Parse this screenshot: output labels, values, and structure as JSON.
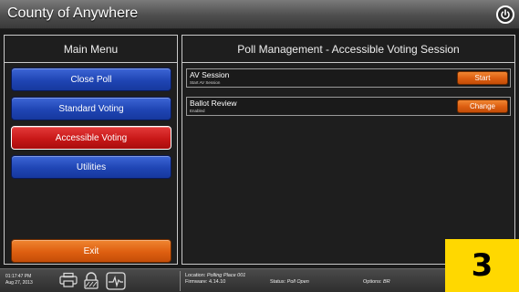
{
  "app": {
    "title": "County of Anywhere"
  },
  "main_menu": {
    "header": "Main Menu",
    "items": [
      {
        "label": "Close Poll",
        "color": "#1f45b4"
      },
      {
        "label": "Standard Voting",
        "color": "#1f45b4"
      },
      {
        "label": "Accessible Voting",
        "color": "#c81818"
      },
      {
        "label": "Utilities",
        "color": "#1f45b4"
      }
    ],
    "exit_label": "Exit"
  },
  "poll_management": {
    "header": "Poll Management - Accessible Voting Session",
    "rows": [
      {
        "title": "AV Session",
        "subtitle": "Start AV Session",
        "action": "Start"
      },
      {
        "title": "Ballot Review",
        "subtitle": "Enabled",
        "action": "Change"
      }
    ]
  },
  "status": {
    "time": "01:17:47 PM",
    "date": "Aug 27, 2013",
    "icons": [
      "printer-icon",
      "lock-icon",
      "heartbeat-icon"
    ],
    "location_label": "Location:",
    "location_value": "Polling Place 001",
    "firmware_label": "Firmware:",
    "firmware_value": "4.14.10",
    "status_label": "Status:",
    "status_value": "Poll Open",
    "options_label": "Options:",
    "options_value": "BR"
  },
  "badge": {
    "text": "3",
    "color": "#ffd800"
  },
  "colors": {
    "accent_blue": "#1f45b4",
    "accent_red": "#c81818",
    "accent_orange": "#de5f10"
  }
}
